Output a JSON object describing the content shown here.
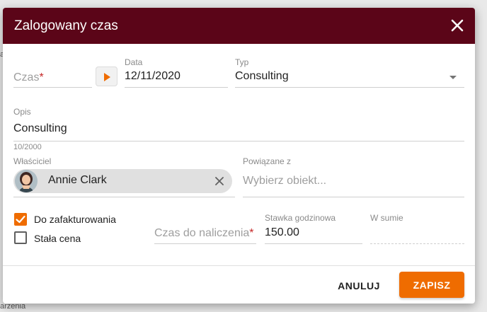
{
  "background": {
    "fragment_top": "a",
    "fragment_bottom": "arzenia"
  },
  "dialog": {
    "title": "Zalogowany czas",
    "close_icon": "close-icon",
    "header_color": "#5b0518",
    "accent_color": "#ef6c00"
  },
  "fields": {
    "czas": {
      "label": "Czas",
      "required_mark": "*",
      "value": ""
    },
    "data": {
      "label": "Data",
      "value": "12/11/2020"
    },
    "typ": {
      "label": "Typ",
      "value": "Consulting"
    },
    "opis": {
      "label": "Opis",
      "value": "Consulting",
      "counter": "10/2000"
    },
    "wlasciciel": {
      "label": "Właściciel",
      "value": "Annie Clark"
    },
    "powiazane": {
      "label": "Powiązane z",
      "placeholder": "Wybierz obiekt..."
    },
    "czas_do_naliczenia": {
      "label": "Czas do naliczenia",
      "required_mark": "*"
    },
    "stawka": {
      "label": "Stawka godzinowa",
      "value": "150.00"
    },
    "w_sumie": {
      "label": "W sumie",
      "value": ""
    }
  },
  "checkboxes": {
    "do_zafakturowania": {
      "label": "Do zafakturowania",
      "checked": true
    },
    "stala_cena": {
      "label": "Stała cena",
      "checked": false
    }
  },
  "actions": {
    "cancel": "ANULUJ",
    "save": "ZAPISZ"
  }
}
